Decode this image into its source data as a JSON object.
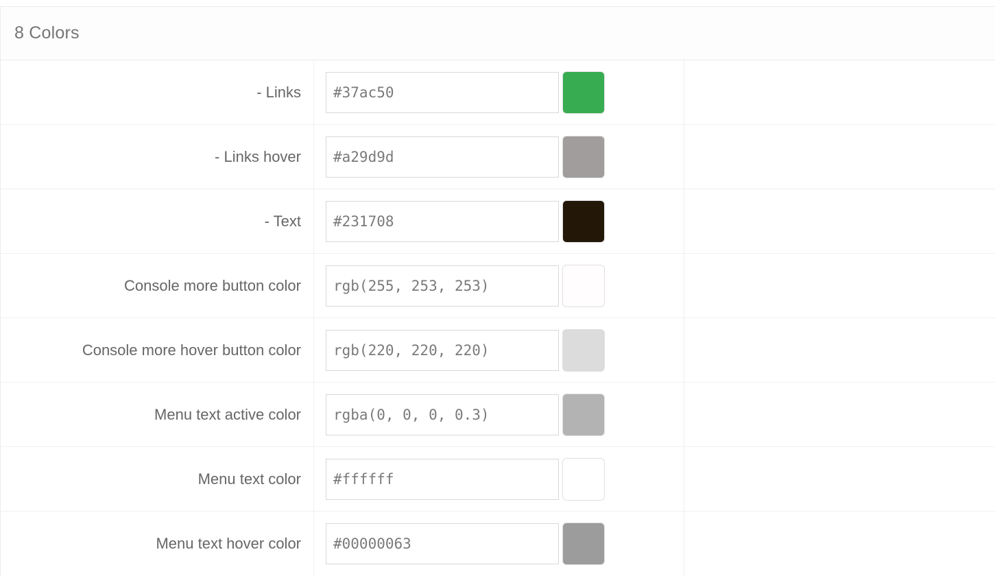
{
  "panel": {
    "title": "8 Colors"
  },
  "rows": [
    {
      "label": "- Links",
      "value": "#37ac50",
      "swatch": "#37ac50"
    },
    {
      "label": "- Links hover",
      "value": "#a29d9d",
      "swatch": "#a29d9d"
    },
    {
      "label": "- Text",
      "value": "#231708",
      "swatch": "#231708"
    },
    {
      "label": "Console more button color",
      "value": "rgb(255, 253, 253)",
      "swatch": "rgb(255, 253, 253)"
    },
    {
      "label": "Console more hover button color",
      "value": "rgb(220, 220, 220)",
      "swatch": "rgb(220, 220, 220)"
    },
    {
      "label": "Menu text active color",
      "value": "rgba(0, 0, 0, 0.3)",
      "swatch": "#b3b3b3"
    },
    {
      "label": "Menu text color",
      "value": "#ffffff",
      "swatch": "#ffffff"
    },
    {
      "label": "Menu text hover color",
      "value": "#00000063",
      "swatch": "#9c9c9c"
    }
  ]
}
